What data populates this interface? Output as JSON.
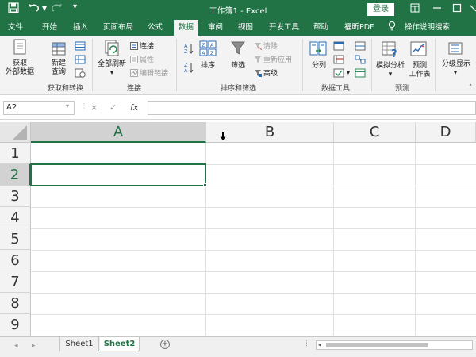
{
  "window": {
    "title": "工作簿1 - Excel",
    "login_label": "登录",
    "quick_access": [
      "save-icon",
      "undo-icon",
      "redo-icon",
      "customize-icon"
    ],
    "window_controls": [
      "ribbon-display-icon",
      "minimize-icon",
      "maximize-icon",
      "close-icon"
    ]
  },
  "tabs": [
    {
      "label": "文件"
    },
    {
      "label": "开始"
    },
    {
      "label": "插入"
    },
    {
      "label": "页面布局"
    },
    {
      "label": "公式"
    },
    {
      "label": "数据",
      "active": true
    },
    {
      "label": "审阅"
    },
    {
      "label": "视图"
    },
    {
      "label": "开发工具"
    },
    {
      "label": "帮助"
    },
    {
      "label": "福昕PDF"
    },
    {
      "label": "操作说明搜索"
    }
  ],
  "ribbon": {
    "get_data": {
      "line1": "获取",
      "line2": "外部数据"
    },
    "new_query": {
      "line1": "新建",
      "line2": "查询"
    },
    "group_get_transform": "获取和转换",
    "refresh_all": "全部刷新",
    "connections": "连接",
    "properties": "属性",
    "edit_links": "编辑链接",
    "group_connections": "连接",
    "sort": "排序",
    "filter": "筛选",
    "clear": "清除",
    "reapply": "重新应用",
    "advanced": "高级",
    "group_sort_filter": "排序和筛选",
    "text_to_columns": "分列",
    "group_data_tools": "数据工具",
    "what_if": "模拟分析",
    "forecast": {
      "line1": "预测",
      "line2": "工作表"
    },
    "group_forecast": "预测",
    "outline": "分级显示"
  },
  "formula_bar": {
    "name_box": "A2",
    "cancel_symbol": "×",
    "enter_symbol": "✓",
    "fx_symbol": "fx",
    "formula": ""
  },
  "grid": {
    "columns": [
      {
        "label": "A",
        "selected": true
      },
      {
        "label": "B"
      },
      {
        "label": "C"
      },
      {
        "label": "D"
      }
    ],
    "rows": [
      {
        "label": "1"
      },
      {
        "label": "2",
        "selected": true
      },
      {
        "label": "3"
      },
      {
        "label": "4"
      },
      {
        "label": "5"
      },
      {
        "label": "6"
      },
      {
        "label": "7"
      },
      {
        "label": "8"
      },
      {
        "label": "9"
      }
    ],
    "active_cell": "A2"
  },
  "sheets": [
    {
      "label": "Sheet1"
    },
    {
      "label": "Sheet2",
      "active": true
    }
  ],
  "colors": {
    "accent": "#217346",
    "ribbon_bg": "#f3f3f3",
    "header_bg": "#f3f3f3",
    "selected_header_bg": "#d2d2d2"
  }
}
